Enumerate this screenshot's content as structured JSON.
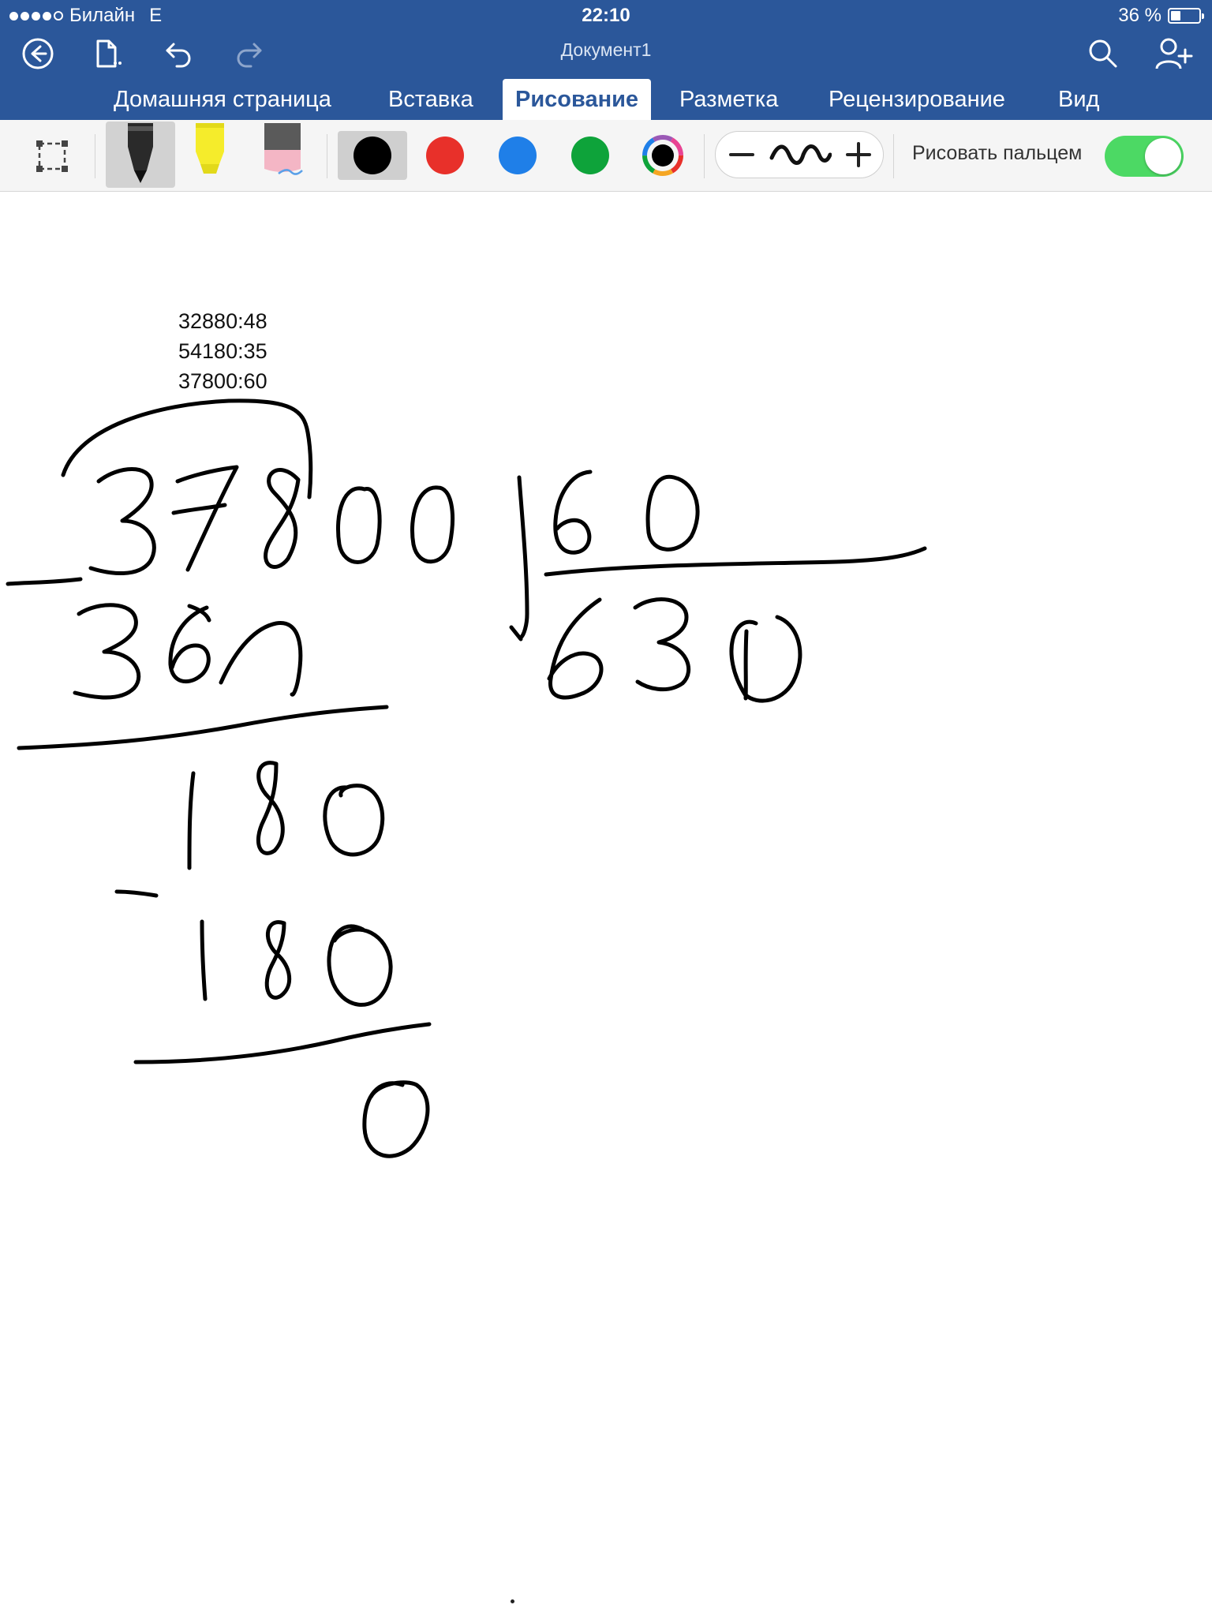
{
  "status_bar": {
    "carrier": "Билайн",
    "network": "E",
    "time": "22:10",
    "battery": "36 %"
  },
  "header": {
    "document_title": "Документ1",
    "icons": [
      "back-icon",
      "file-icon",
      "undo-icon",
      "redo-icon",
      "search-icon",
      "share-person-icon"
    ]
  },
  "tabs": [
    {
      "label": "Домашняя страница",
      "active": false
    },
    {
      "label": "Вставка",
      "active": false
    },
    {
      "label": "Рисование",
      "active": true
    },
    {
      "label": "Разметка",
      "active": false
    },
    {
      "label": "Рецензирование",
      "active": false
    },
    {
      "label": "Вид",
      "active": false
    }
  ],
  "toolbar": {
    "tools": [
      "lasso-select-icon",
      "pen-icon",
      "highlighter-icon",
      "eraser-icon"
    ],
    "selected_tool": "pen",
    "colors": [
      "#000000",
      "#e8302a",
      "#1f7fe8",
      "#0ea33a"
    ],
    "selected_color": "#000000",
    "more_colors_icon": "color-wheel-icon",
    "thickness_controls": [
      "minus-icon",
      "stroke-preview-icon",
      "plus-icon"
    ],
    "draw_with_finger_label": "Рисовать пальцем",
    "draw_with_finger_on": true
  },
  "document": {
    "typed_lines": [
      "32880:48",
      "54180:35",
      "37800:60"
    ],
    "handwriting": {
      "dividend": "37800",
      "divisor": "60",
      "quotient": "630",
      "steps": [
        "360",
        "180",
        "180",
        "0"
      ]
    }
  },
  "colors": {
    "header_bg": "#2b579a",
    "toggle_on": "#4cd964",
    "toolbar_bg": "#f5f5f5"
  }
}
